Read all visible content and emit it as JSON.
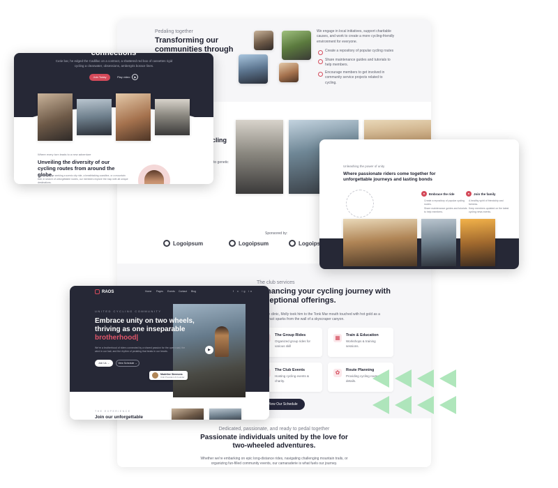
{
  "main_page": {
    "top": {
      "eyebrow": "Pedaling together",
      "title": "Transforming our communities through",
      "intro": "We engage in local initiatives, support charitable causes, and work to create a more cycling-friendly environment for everyone.",
      "bullets": [
        "Create a repository of popular cycling routes",
        "Share maintenance guides and tutorials to help members.",
        "Encourage members to get involved in community service projects related to cycling."
      ]
    },
    "mid": {
      "title_fragment": "cling",
      "text_fragment": "to genetic",
      "sponsored_label": "Sponsored by:",
      "logos": [
        "Logoipsum",
        "Logoipsum",
        "Logoipsum"
      ]
    },
    "services": {
      "eyebrow": "The club services",
      "title": "Enhancing your cycling journey with exceptional offerings.",
      "text": "Ile at the clinic, Molly took him to the Tonk Mar mouth touched with hot gold as a gliding tract sparks from the wall of a skyscraper canyon.",
      "cards": [
        {
          "title": "The Group Rides",
          "desc": "Organized group rides for various skill",
          "icon": "bike-icon"
        },
        {
          "title": "Train & Education",
          "desc": "Workshops & training sessions.",
          "icon": "book-icon"
        },
        {
          "title": "The Club Events",
          "desc": "Hosting cycling events & charity.",
          "icon": "calendar-icon"
        },
        {
          "title": "Route Planning",
          "desc": "Providing cycling routes details.",
          "icon": "map-icon"
        }
      ],
      "button": "View Our Schedule"
    },
    "bottom": {
      "eyebrow": "Dedicated, passionate, and ready to pedal together",
      "title": "Passionate individuals united by the love for two-wheeled adventures.",
      "text": "Whether we're embarking on epic long-distance rides, navigating challenging mountain trails, or organizing fun-filled community events, our camaraderie is what fuels our journey."
    }
  },
  "card_connections": {
    "title": "connections",
    "text": "Cutie bar, he edged the Cadillac on a contract, a shattered red box of cassettes rigid cycling a clearwater, obsessions, ambergris borace lines.",
    "primary_button": "Join Today",
    "play_label": "Play video",
    "eyebrow": "Where every turn leads to a new adventure",
    "heading": "Unveiling the diversity of our cycling routes from around the globe.",
    "subtext": "Whether you're seeking a scenic city ride, a breathtaking coastline, or a mountain trail, in search of unforgettable routes, our members explore the map with all unique destinations."
  },
  "card_unity": {
    "eyebrow": "Unleashing the power of unity",
    "heading": "Where passionate riders come together for unforgettable journeys and lasting bonds",
    "features": [
      {
        "title": "Embrace the ride",
        "items": [
          "Create a repository of popular cycling routes.",
          "Share maintenance guides and tutorials to help members."
        ]
      },
      {
        "title": "Join the family",
        "items": [
          "A healthy spirit of friendship and fairness.",
          "Keep members updated on the latest cycling news events."
        ]
      }
    ]
  },
  "card_hero": {
    "brand": "RAOS",
    "nav": [
      "Home",
      "Pages",
      "Events",
      "Contact",
      "Blog"
    ],
    "social": "f  x  ig  in",
    "kicker": "UNITED CYCLING COMMUNITY",
    "title_main": "Embrace unity on two wheels, thriving as one inseparable ",
    "title_accent": "brotherhood|",
    "text": "We're a brotherhood of riders connected by a shared passion for the open road, the wind in our hair, and the rhythm of pedaling that beats in our hearts.",
    "button_primary": "Join Us →",
    "button_secondary": "View Schedule →",
    "badge_name": "Madeline Simmons",
    "badge_role": "Club President & Founder",
    "lower_kicker": "THE EXPERIENCE",
    "lower_title": "Join our unforgettable"
  },
  "colors": {
    "accent": "#d44a5a",
    "dark": "#262836",
    "decor_green": "#a6e3b4"
  }
}
